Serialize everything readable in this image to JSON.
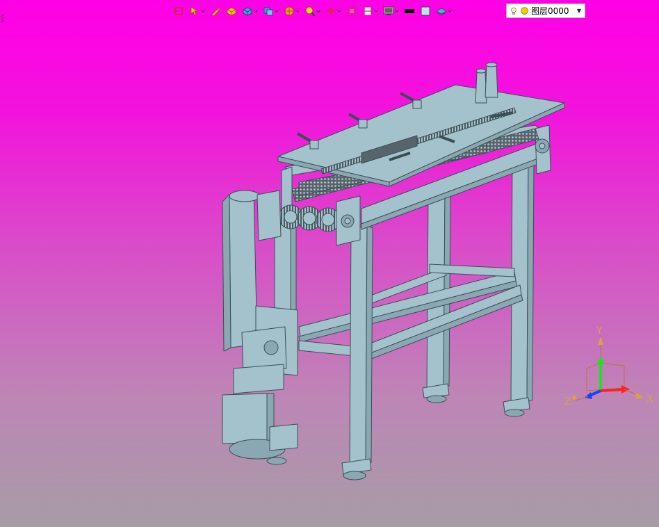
{
  "toolbar": {
    "buttons": [
      {
        "id": "snap",
        "icon": "snap-point-icon",
        "dropdown": false
      },
      {
        "id": "select-filter",
        "icon": "select-filter-icon",
        "dropdown": true
      },
      {
        "id": "pen",
        "icon": "pen-icon",
        "dropdown": false
      },
      {
        "id": "box",
        "icon": "yellow-box-icon",
        "dropdown": false
      },
      {
        "id": "solid",
        "icon": "blue-solid-icon",
        "dropdown": true
      },
      {
        "id": "view-orient",
        "icon": "view-orient-icon",
        "dropdown": true
      },
      {
        "id": "render",
        "icon": "render-style-icon",
        "dropdown": true
      },
      {
        "id": "zoom",
        "icon": "zoom-icon",
        "dropdown": true
      },
      {
        "id": "rotate",
        "icon": "rotate-icon",
        "dropdown": true
      },
      {
        "id": "fit",
        "icon": "fit-view-icon",
        "dropdown": false
      },
      {
        "id": "section",
        "icon": "section-icon",
        "dropdown": true
      },
      {
        "id": "display",
        "icon": "monitor-icon",
        "dropdown": true
      },
      {
        "id": "line-color",
        "icon": "black-line-icon",
        "dropdown": false
      },
      {
        "id": "fill-color",
        "icon": "light-blue-square-icon",
        "dropdown": false
      },
      {
        "id": "layer-tool",
        "icon": "layer-icon",
        "dropdown": true
      }
    ],
    "layer": {
      "value": "图层0000",
      "icons": [
        "bulb-icon",
        "yellow-circle-icon"
      ]
    }
  },
  "colors": {
    "background_top": "#ff00e6",
    "background_bottom": "#a69ca6",
    "model_face": "#a4c2cc",
    "model_edge": "#3a4e55",
    "axis_x": "#ff2020",
    "axis_y": "#20e020",
    "axis_z": "#2040ff",
    "axis_label": "#d8a050"
  },
  "triad": {
    "x": "X",
    "y": "Y",
    "z": "Z"
  }
}
